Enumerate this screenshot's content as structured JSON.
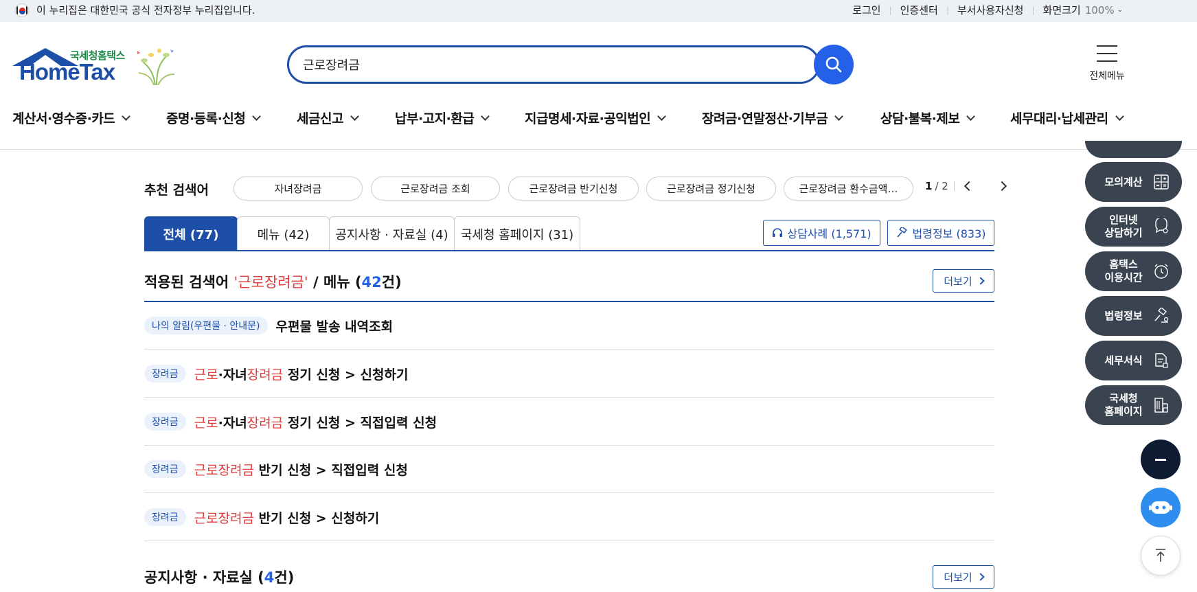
{
  "govbar": {
    "text": "이 누리집은 대한민국 공식 전자정부 누리집입니다.",
    "login": "로그인",
    "cert_center": "인증센터",
    "dept_user": "부서사용자신청",
    "zoom_label": "화면크기",
    "zoom_value": "100%"
  },
  "header": {
    "brand_ko": "국세청홈택스",
    "brand_en": "HomeTax",
    "search_value": "근로장려금",
    "all_menu": "전체메뉴"
  },
  "gnb": [
    "계산서·영수증·카드",
    "증명·등록·신청",
    "세금신고",
    "납부·고지·환급",
    "지급명세·자료·공익법인",
    "장려금·연말정산·기부금",
    "상담·불복·제보",
    "세무대리·납세관리"
  ],
  "recommended": {
    "title": "추천 검색어",
    "chips": [
      "자녀장려금",
      "근로장려금 조회",
      "근로장려금 반기신청",
      "근로장려금 정기신청",
      "근로장려금 환수금액…"
    ],
    "page_current": "1",
    "page_total": "/ 2"
  },
  "tabs": [
    {
      "label": "전체 (77)",
      "active": true
    },
    {
      "label": "메뉴 (42)",
      "active": false
    },
    {
      "label": "공지사항 · 자료실 (4)",
      "active": false
    },
    {
      "label": "국세청 홈페이지 (31)",
      "active": false
    }
  ],
  "side_buttons": {
    "consult_cases": "상담사례 (1,571)",
    "law_info": "법령정보 (833)"
  },
  "menu_section": {
    "prefix": "적용된 검색어 ",
    "keyword": "'근로장려금'",
    "mid": " / 메뉴 (",
    "count": "42",
    "suffix": "건)",
    "more": "더보기"
  },
  "results": [
    {
      "badge": "나의 알림(우편물 · 안내문)",
      "hl1": "",
      "t1": "우편물 발송 내역조회",
      "hl2": "",
      "t2": ""
    },
    {
      "badge": "장려금",
      "hl1": "근로",
      "t1": "·자녀",
      "hl2": "장려금",
      "t2": " 정기 신청 > 신청하기"
    },
    {
      "badge": "장려금",
      "hl1": "근로",
      "t1": "·자녀",
      "hl2": "장려금",
      "t2": " 정기 신청 > 직접입력 신청"
    },
    {
      "badge": "장려금",
      "hl1": "근로장려금",
      "t1": " 반기 신청 > 직접입력 신청",
      "hl2": "",
      "t2": ""
    },
    {
      "badge": "장려금",
      "hl1": "근로장려금",
      "t1": " 반기 신청 > 신청하기",
      "hl2": "",
      "t2": ""
    }
  ],
  "notice_section": {
    "prefix": "공지사항 · 자료실 (",
    "count": "4",
    "suffix": "건)",
    "more": "더보기"
  },
  "quick_menu": [
    {
      "label": "모의계산",
      "icon": "calculator-icon"
    },
    {
      "label": "인터넷\n상담하기",
      "icon": "chat-icon"
    },
    {
      "label": "홈택스\n이용시간",
      "icon": "clock-icon"
    },
    {
      "label": "법령정보",
      "icon": "gavel-icon"
    },
    {
      "label": "세무서식",
      "icon": "document-icon"
    },
    {
      "label": "국세청\n홈페이지",
      "icon": "building-icon"
    }
  ],
  "colors": {
    "brand_blue": "#1d4ea8",
    "accent_blue": "#2461e8",
    "highlight_red": "#e03b3b",
    "quick_menu_bg": "#3a4350"
  }
}
